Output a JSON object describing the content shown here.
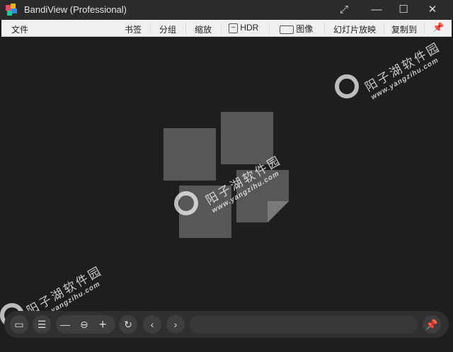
{
  "window": {
    "title": "BandiView (Professional)"
  },
  "toolbar": {
    "file": "文件",
    "bookmark": "书签",
    "group": "分组",
    "zoom": "缩放",
    "hdr": "HDR",
    "image": "图像",
    "slideshow": "幻灯片放映",
    "copy_to": "复制到"
  },
  "watermark": {
    "name": "阳子湖软件园",
    "url": "www.yangzihu.com"
  },
  "colors": {
    "titlebar": "#2b2b2b",
    "toolbar": "#f0f0f0",
    "background": "#1e1e1e"
  }
}
